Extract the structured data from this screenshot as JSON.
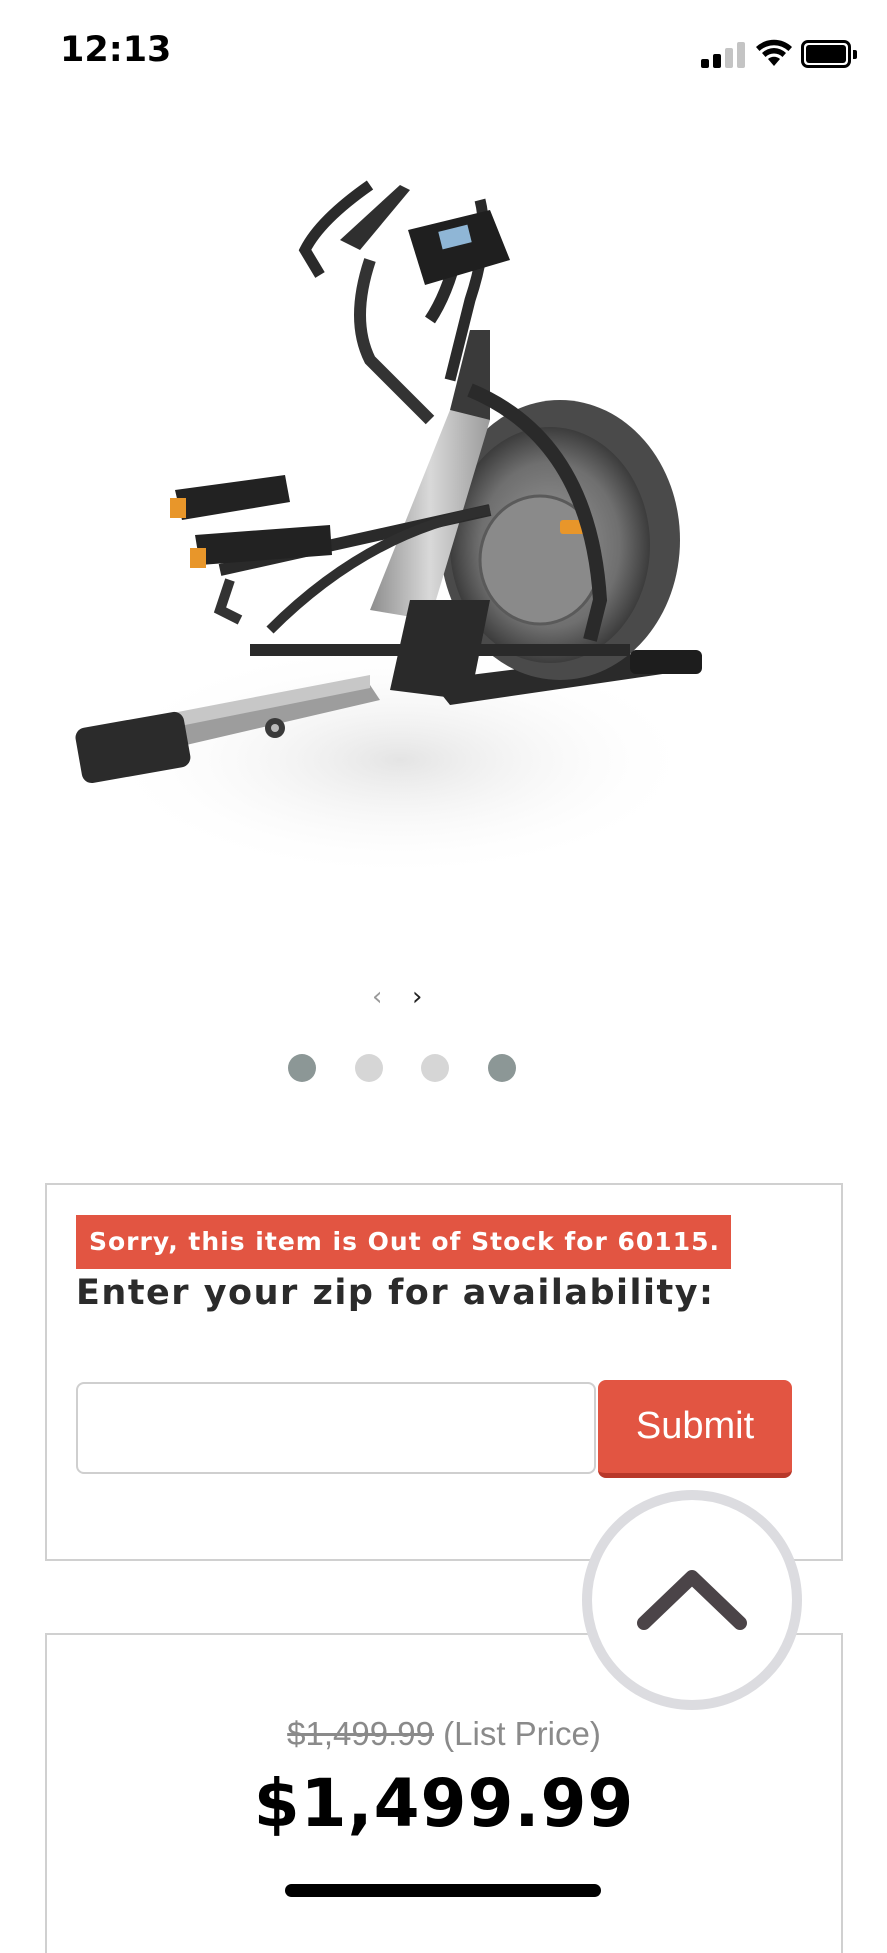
{
  "status_bar": {
    "time": "12:13",
    "signal_icon": "cellular-signal-icon",
    "wifi_icon": "wifi-icon",
    "battery_icon": "battery-icon"
  },
  "product": {
    "image_icon": "elliptical-trainer-image"
  },
  "carousel": {
    "prev_arrow": "‹",
    "next_arrow": "›",
    "slide_count": 4,
    "active_dots": [
      1,
      4
    ]
  },
  "availability": {
    "out_of_stock_message": "Sorry, this item is Out of Stock for 60115.",
    "zip_prompt": "Enter your zip for availability:",
    "zip_value": "",
    "zip_placeholder": "",
    "submit_label": "Submit"
  },
  "pricing": {
    "list_price": "$1,499.99",
    "list_price_label": "(List Price)",
    "sale_price": "$1,499.99"
  },
  "colors": {
    "accent_red": "#e25542",
    "dot_active": "#8c9796",
    "dot_inactive": "#d6d6d6"
  }
}
